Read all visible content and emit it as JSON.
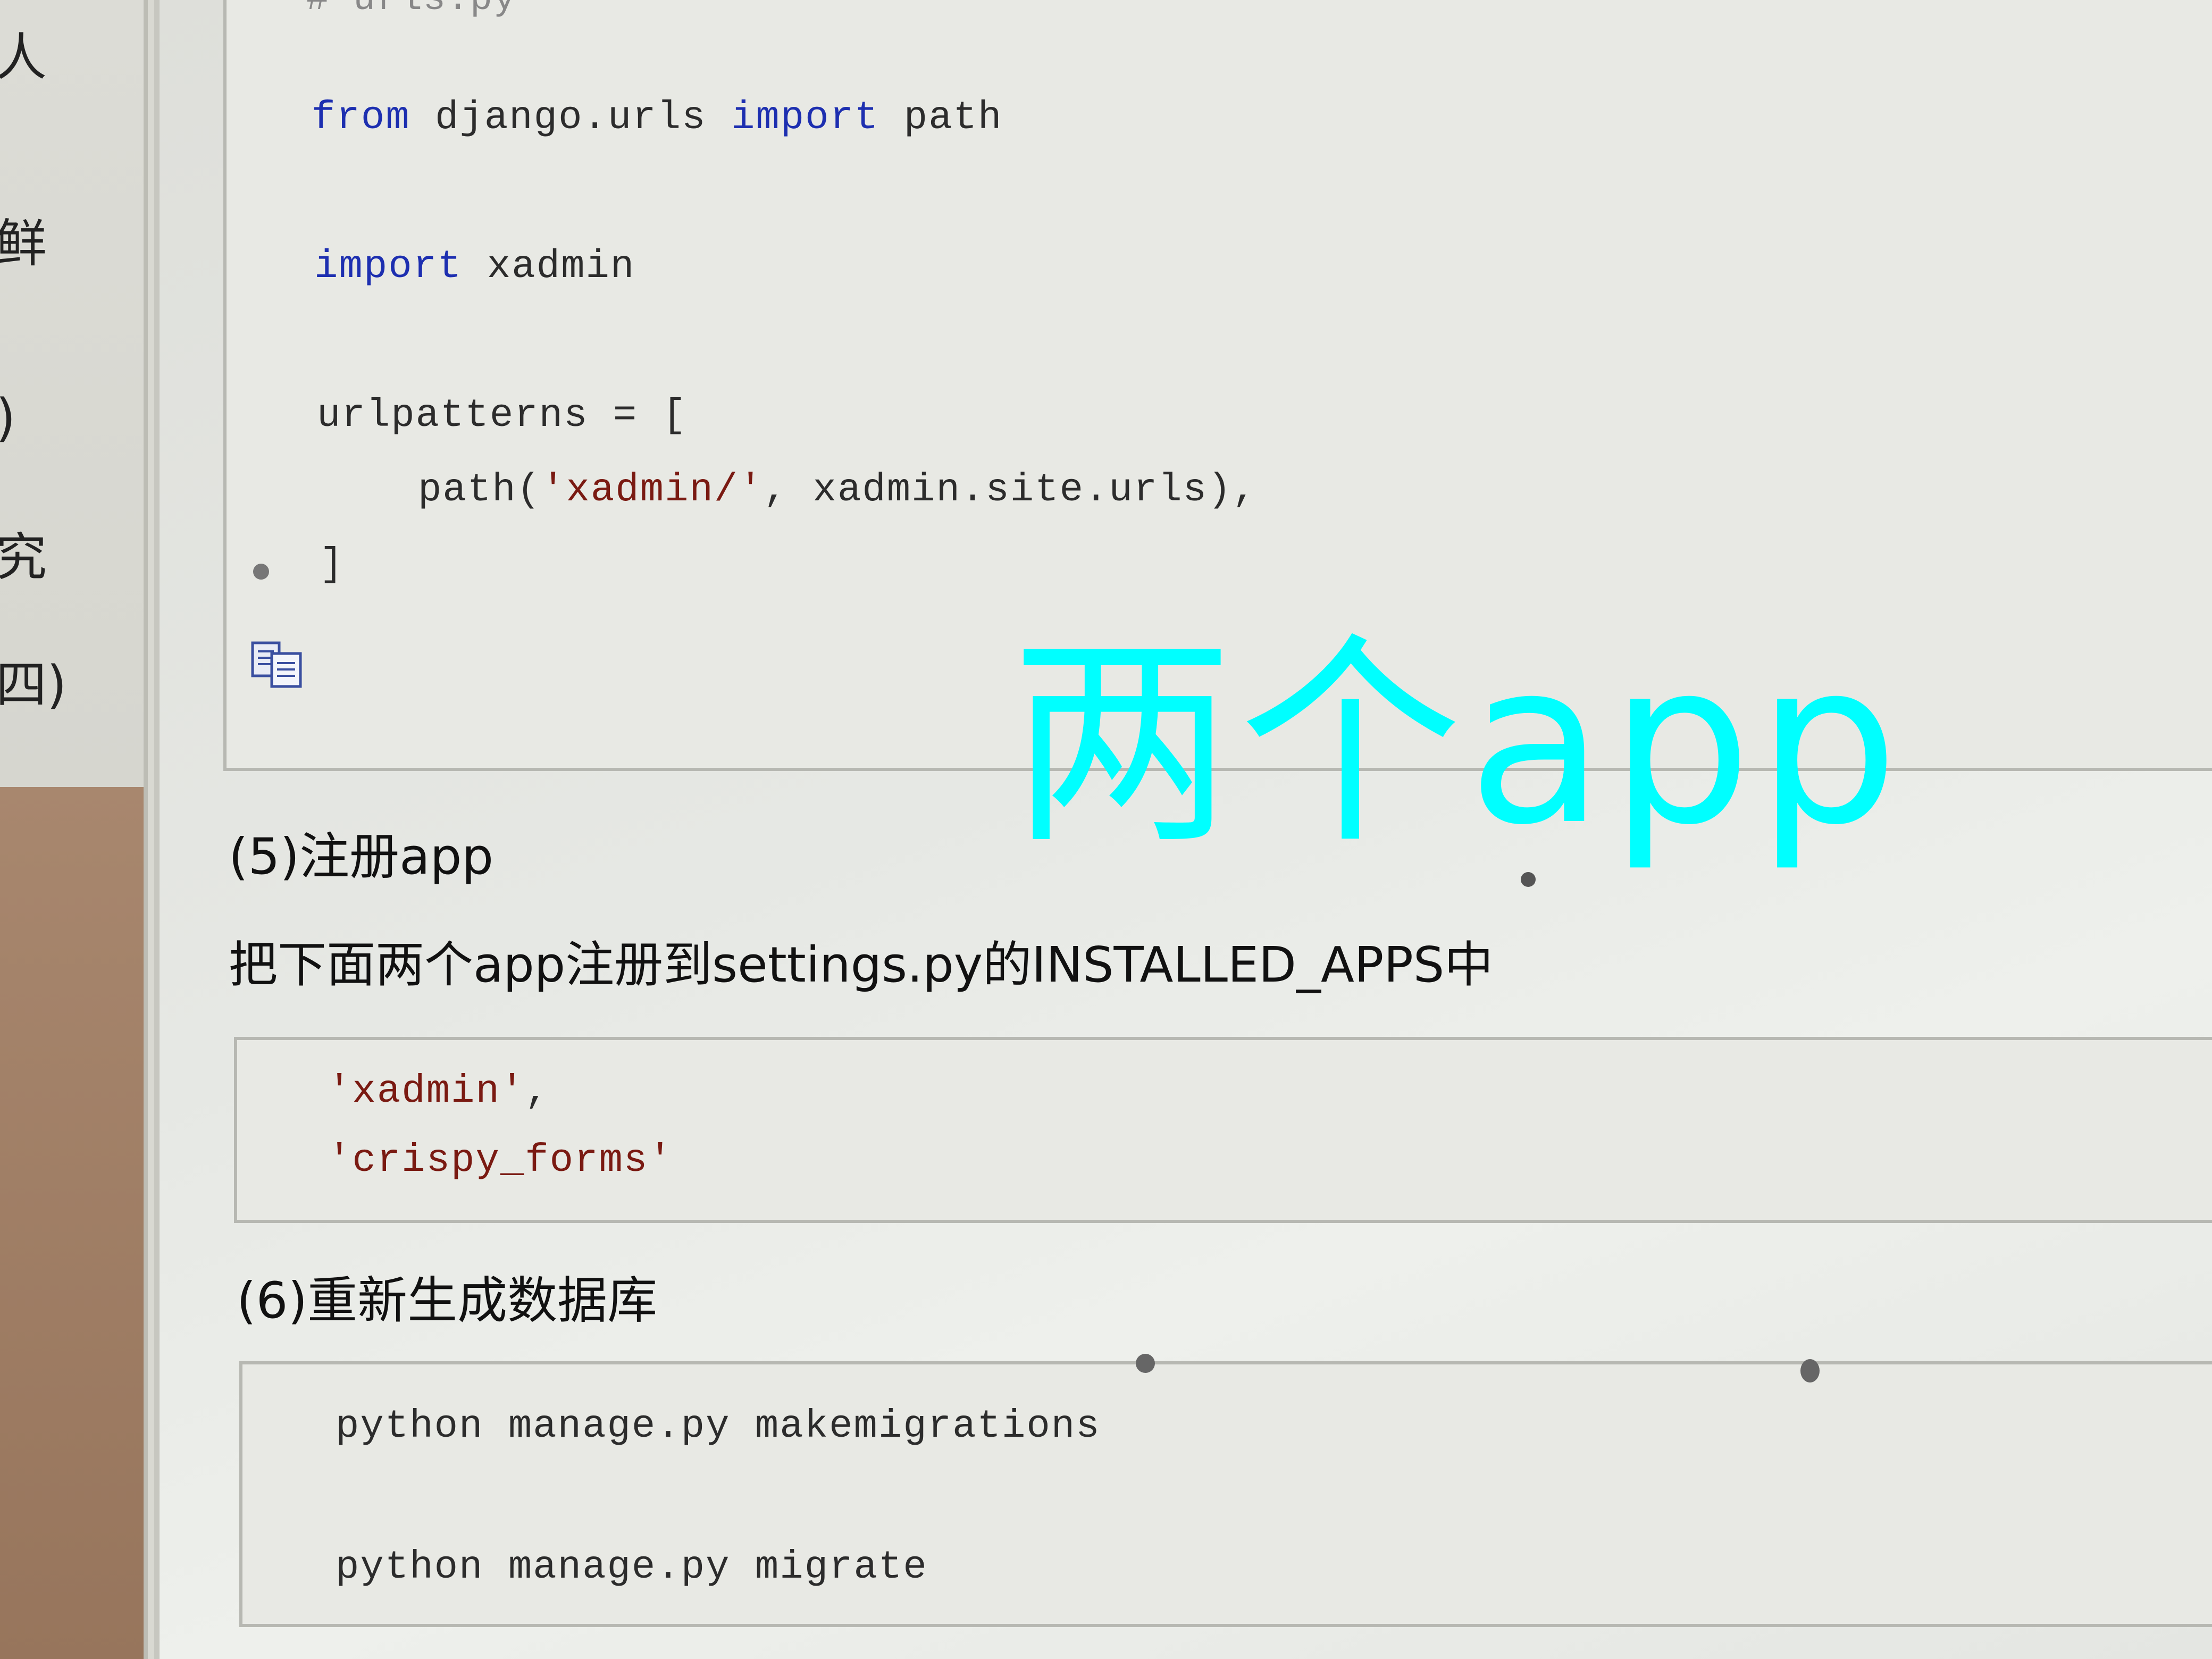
{
  "sidebar": {
    "fragments": [
      "人",
      "鲜",
      ")",
      "究",
      "四)"
    ]
  },
  "code1": {
    "header_partial": "# urls.py",
    "line1_kw1": "from",
    "line1_mod": " django.urls ",
    "line1_kw2": "import",
    "line1_name": " path",
    "line2_kw": "import",
    "line2_name": " xadmin",
    "line3": "urlpatterns = [",
    "line4_pre": "path(",
    "line4_str": "'xadmin/'",
    "line4_post": ", xadmin.site.urls),",
    "line5": "]",
    "copy_icon": "copy-icon"
  },
  "overlay_text": "两个app",
  "section5": {
    "heading": "(5)注册app",
    "description": "把下面两个app注册到settings.py的INSTALLED_APPS中"
  },
  "code2": {
    "line1_str": "'xadmin'",
    "line1_post": ",",
    "line2_str": "'crispy_forms'"
  },
  "section6": {
    "heading": "(6)重新生成数据库"
  },
  "code3": {
    "line1": "python manage.py makemigrations",
    "line2": "python manage.py migrate"
  },
  "colors": {
    "overlay": "#00ffff",
    "keyword": "#1d2fb0",
    "string": "#7a1a12"
  }
}
